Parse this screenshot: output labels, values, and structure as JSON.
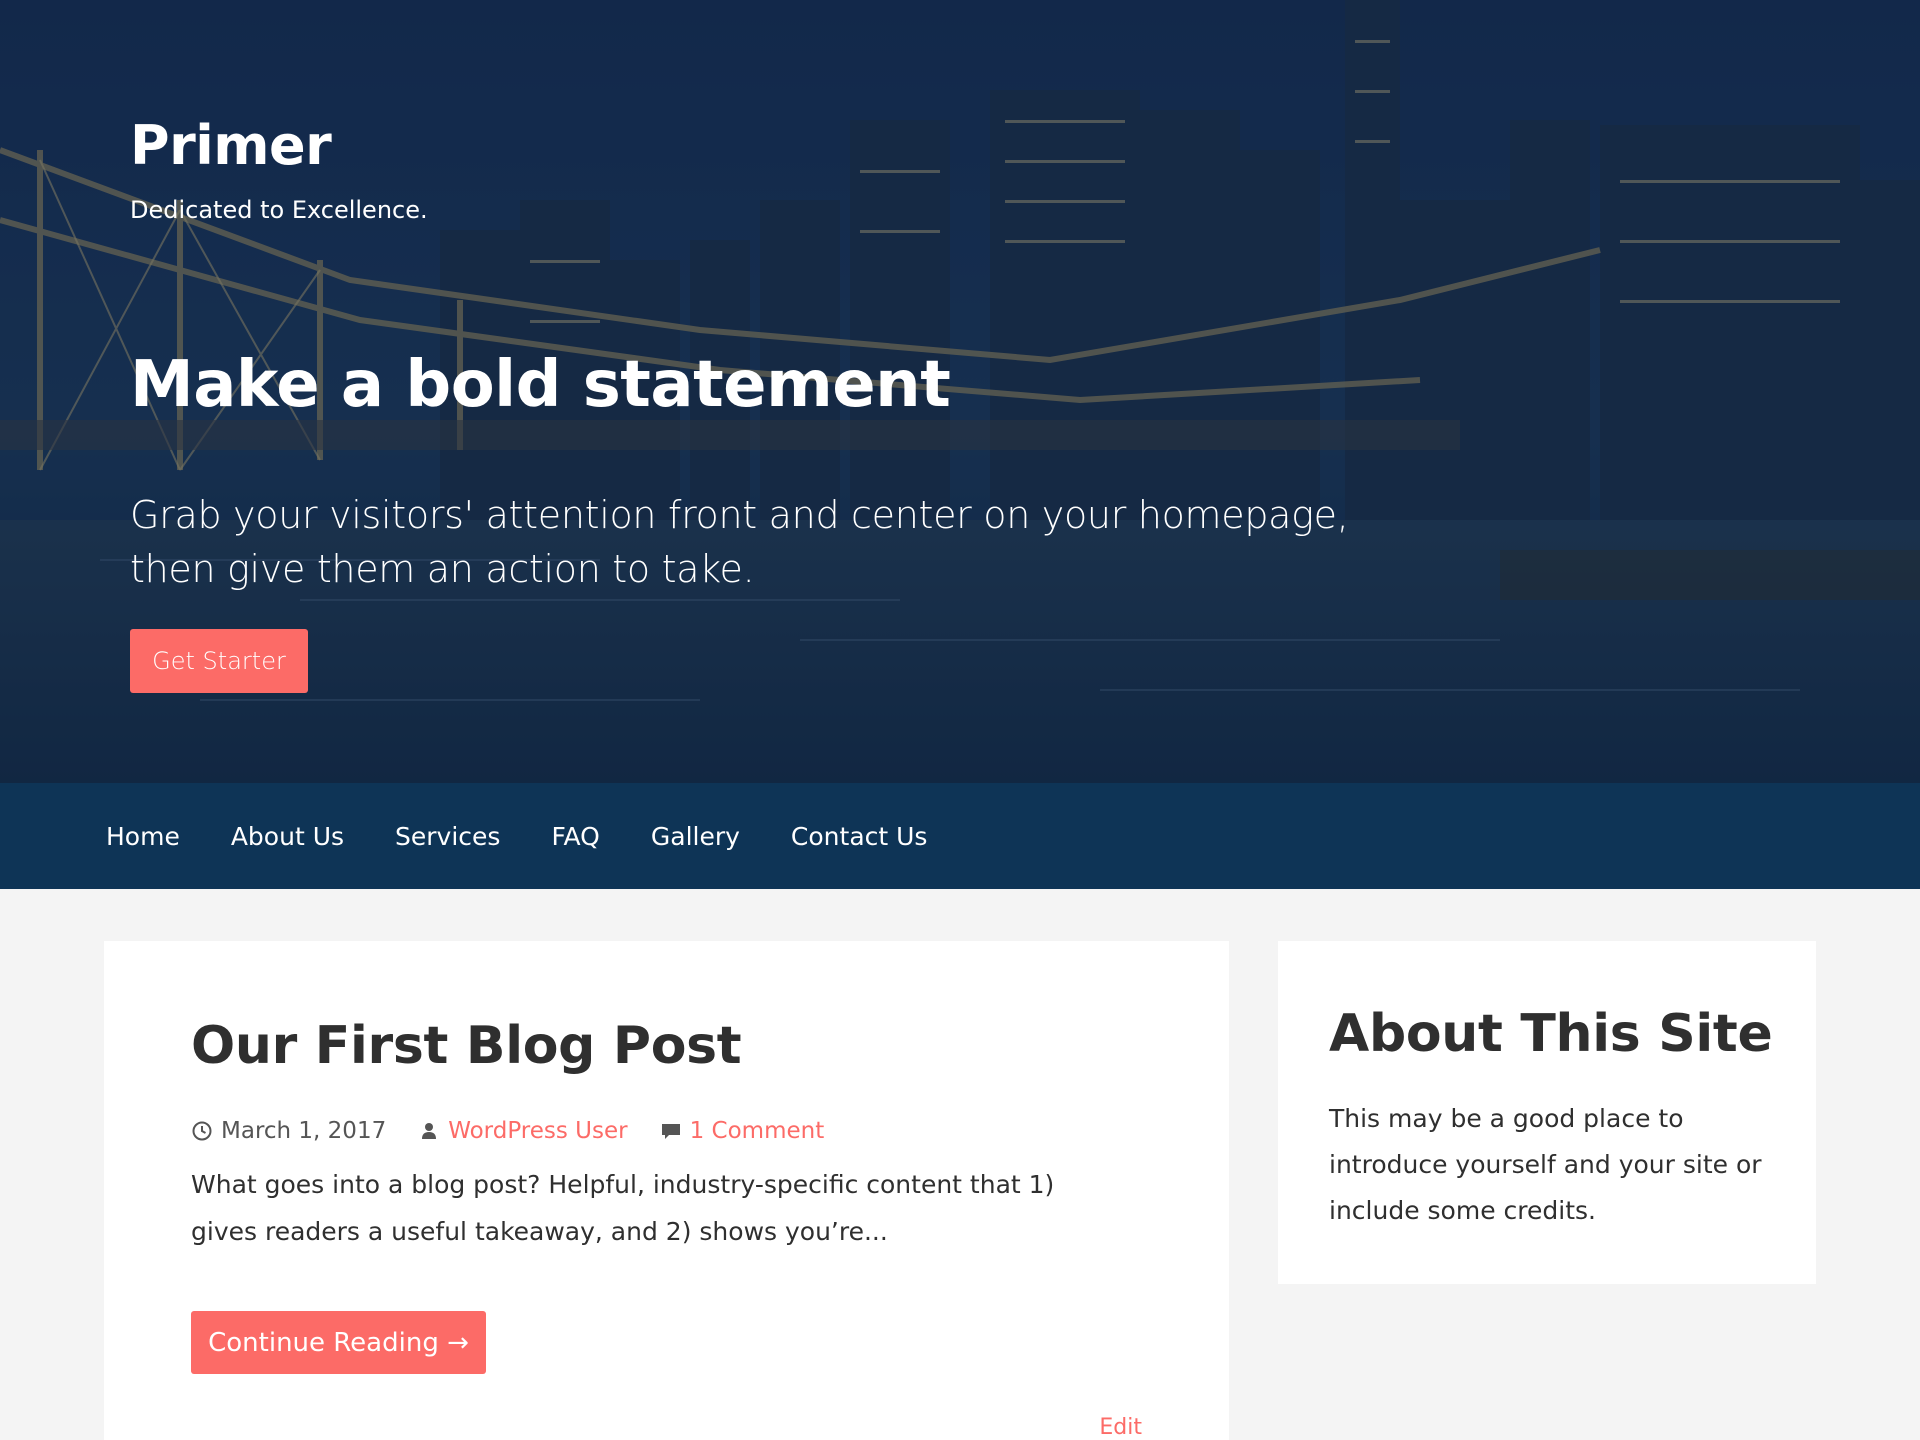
{
  "site": {
    "title": "Primer",
    "tagline": "Dedicated to Excellence."
  },
  "hero": {
    "headline": "Make a bold statement",
    "text": "Grab your visitors' attention front and center on your homepage, then give them an action to take.",
    "button_label": "Get Starter"
  },
  "nav": {
    "items": [
      {
        "label": "Home"
      },
      {
        "label": "About Us"
      },
      {
        "label": "Services"
      },
      {
        "label": "FAQ"
      },
      {
        "label": "Gallery"
      },
      {
        "label": "Contact Us"
      }
    ]
  },
  "post": {
    "title": "Our First Blog Post",
    "date": "March 1, 2017",
    "author": "WordPress User",
    "comments": "1 Comment",
    "excerpt": "What goes into a blog post? Helpful, industry-specific content that 1) gives readers a useful takeaway, and 2) shows you’re...",
    "continue_label": "Continue Reading →",
    "edit_label": "Edit",
    "icons": [
      "clock-icon",
      "user-icon",
      "comment-icon"
    ]
  },
  "sidebar": {
    "widget_title": "About This Site",
    "widget_text": "This may be a good place to introduce yourself and your site or include some credits."
  },
  "colors": {
    "accent": "#fc6b67",
    "nav_bg": "#0e3456",
    "page_bg": "#f4f4f4",
    "text": "#2f2f2f"
  }
}
